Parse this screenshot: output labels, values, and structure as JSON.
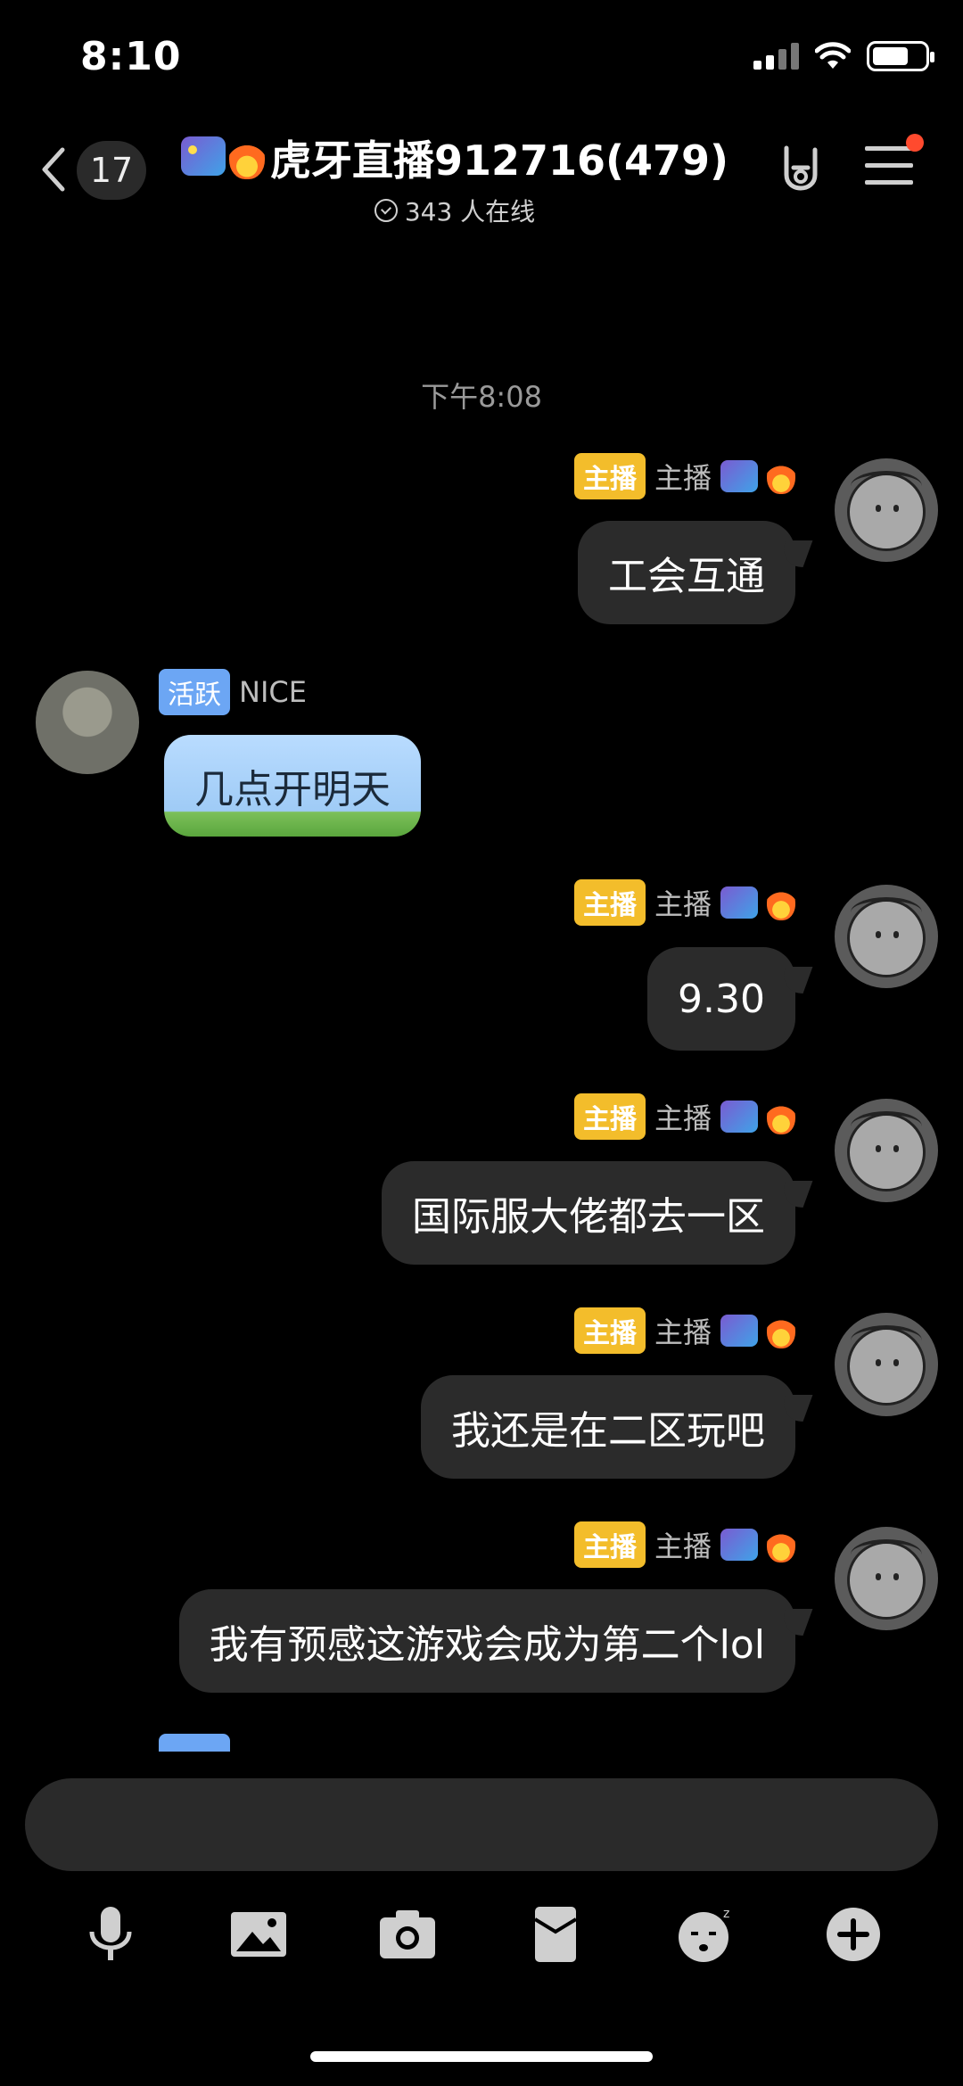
{
  "status_bar": {
    "time": "8:10"
  },
  "header": {
    "unread_count": "17",
    "title": "虎牙直播912716(479)",
    "online_text": "343 人在线"
  },
  "chat": {
    "time_divider": "下午8:08",
    "messages": [
      {
        "side": "right",
        "tag": "主播",
        "name": "主播",
        "text": "工会互通"
      },
      {
        "side": "left",
        "tag": "活跃",
        "name": "NICE",
        "text": "几点开明天"
      },
      {
        "side": "right",
        "tag": "主播",
        "name": "主播",
        "text": "9.30"
      },
      {
        "side": "right",
        "tag": "主播",
        "name": "主播",
        "text": "国际服大佬都去一区"
      },
      {
        "side": "right",
        "tag": "主播",
        "name": "主播",
        "text": "我还是在二区玩吧"
      },
      {
        "side": "right",
        "tag": "主播",
        "name": "主播",
        "text": "我有预感这游戏会成为第二个lol"
      }
    ]
  },
  "colors": {
    "background": "#000000",
    "bubble": "#2b2b2b",
    "host_tag": "#f3bd2b",
    "active_tag": "#6ca6f4",
    "notification_dot": "#ff4a2e"
  },
  "toolbar_icons": [
    "microphone-icon",
    "image-icon",
    "camera-icon",
    "red-packet-icon",
    "emoji-icon",
    "plus-icon"
  ]
}
